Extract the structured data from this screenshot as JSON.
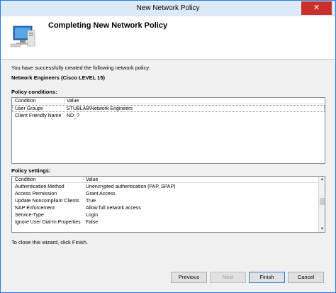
{
  "window": {
    "title": "New Network Policy",
    "close_glyph": "✕"
  },
  "header": {
    "title": "Completing New Network Policy",
    "icon": "network-computer-icon"
  },
  "intro_text": "You have successfully created the following network policy:",
  "policy_name": "Network Engineers (Cisco LEVEL 15)",
  "conditions": {
    "label": "Policy conditions:",
    "columns": [
      "Condition",
      "Value"
    ],
    "rows": [
      [
        "User Groups",
        "STUBLAB\\Network Engineers"
      ],
      [
        "Client Friendly Name",
        "ND_?"
      ]
    ]
  },
  "settings": {
    "label": "Policy settings:",
    "columns": [
      "Condition",
      "Value"
    ],
    "rows": [
      [
        "Authentication Method",
        "Unencrypted authentication (PAP, SPAP)"
      ],
      [
        "Access Permission",
        "Grant Access"
      ],
      [
        "Update Noncompliant Clients",
        "True"
      ],
      [
        "NAP Enforcement",
        "Allow full network access"
      ],
      [
        "Service-Type",
        "Login"
      ],
      [
        "Ignore User Dial-In Properties",
        "False"
      ]
    ]
  },
  "close_note": "To close this wizard, click Finish.",
  "buttons": {
    "previous": "Previous",
    "next": "Next",
    "finish": "Finish",
    "cancel": "Cancel"
  }
}
